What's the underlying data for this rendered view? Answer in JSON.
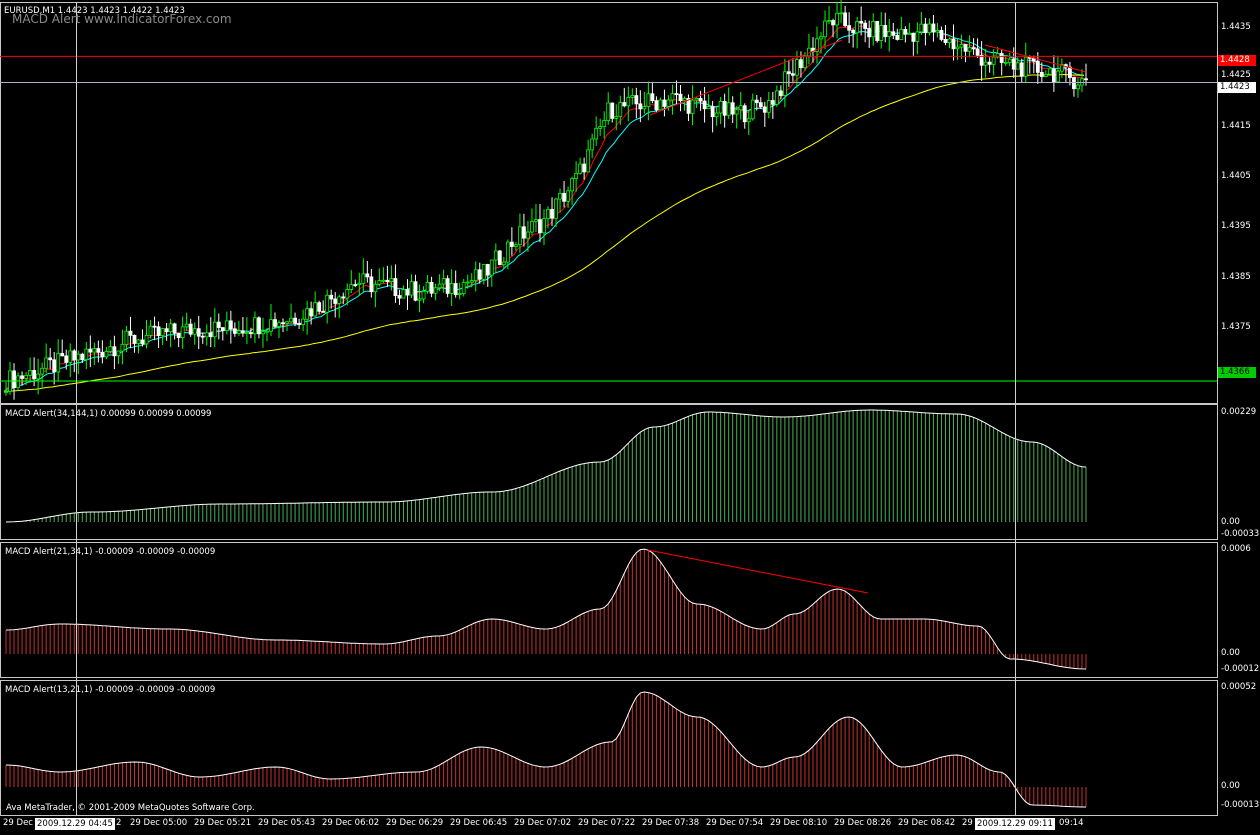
{
  "main": {
    "title": "EURUSD,M1  1.4423 1.4423 1.4422 1.4423",
    "watermark": "MACD Alert  www.IndicatorForex.com",
    "price_labels": [
      "1.4435",
      "1.4425",
      "1.4415",
      "1.4405",
      "1.4395",
      "1.4385",
      "1.4375",
      "1.4365"
    ],
    "tags": {
      "red": "1.4428",
      "white": "1.4423",
      "green": "1.4366"
    }
  },
  "panels": [
    {
      "title": "MACD Alert(34,144,1) 0.00099 0.00099 0.00099",
      "top": "0.00229",
      "zero": "0.00",
      "bottom": "-0.00033"
    },
    {
      "title": "MACD Alert(21,34,1) -0.00009 -0.00009 -0.00009",
      "top": "0.0006",
      "zero": "0.00",
      "bottom": "-0.00012"
    },
    {
      "title": "MACD Alert(13,21,1) -0.00009 -0.00009 -0.00009",
      "top": "0.00052",
      "zero": "0.00",
      "bottom": "-0.00013"
    }
  ],
  "time_axis": {
    "labels": [
      "2",
      "29 Dec 05:00",
      "29 Dec 05:21",
      "29 Dec 05:43",
      "29 Dec 06:02",
      "29 Dec 06:29",
      "29 Dec 06:45",
      "29 Dec 07:02",
      "29 Dec 07:22",
      "29 Dec 07:38",
      "29 Dec 07:54",
      "29 Dec 08:10",
      "29 Dec 08:26",
      "29 Dec 08:42",
      "29",
      "09:14"
    ],
    "left_start": "29 Dec",
    "crosshair_left": "2009.12.29 04:45",
    "crosshair_right": "2009.12.29 09:11"
  },
  "copyright": "Ava MetaTrader, © 2001-2009 MetaQuotes Software Corp.",
  "colors": {
    "up_candle": "#00ff00",
    "down_candle": "#ffffff",
    "ema_fast": "#ff0000",
    "ema_mid": "#00ffff",
    "ema_slow": "#ffff00",
    "hist_green": "#4caf50",
    "hist_red": "#c83232",
    "grid_line": "#ffffff",
    "level_red": "#ff0000",
    "level_green": "#00ff00"
  },
  "chart_data": {
    "type": "candlestick",
    "symbol": "EURUSD",
    "timeframe": "M1",
    "y_range": [
      1.4362,
      1.4438
    ],
    "approx_close_path": [
      1.4366,
      1.4368,
      1.437,
      1.4372,
      1.4374,
      1.4375,
      1.4376,
      1.4376,
      1.4377,
      1.4378,
      1.4381,
      1.4385,
      1.4384,
      1.4383,
      1.4384,
      1.4386,
      1.4393,
      1.4397,
      1.4405,
      1.4418,
      1.4419,
      1.442,
      1.4418,
      1.4417,
      1.4419,
      1.4427,
      1.4435,
      1.4433,
      1.4432,
      1.4433,
      1.443,
      1.4427,
      1.4426,
      1.4425,
      1.4423
    ],
    "levels": [
      1.4428,
      1.4423,
      1.4366
    ],
    "indicators": [
      "MACD Alert(34,144,1)",
      "MACD Alert(21,34,1)",
      "MACD Alert(13,21,1)"
    ]
  }
}
